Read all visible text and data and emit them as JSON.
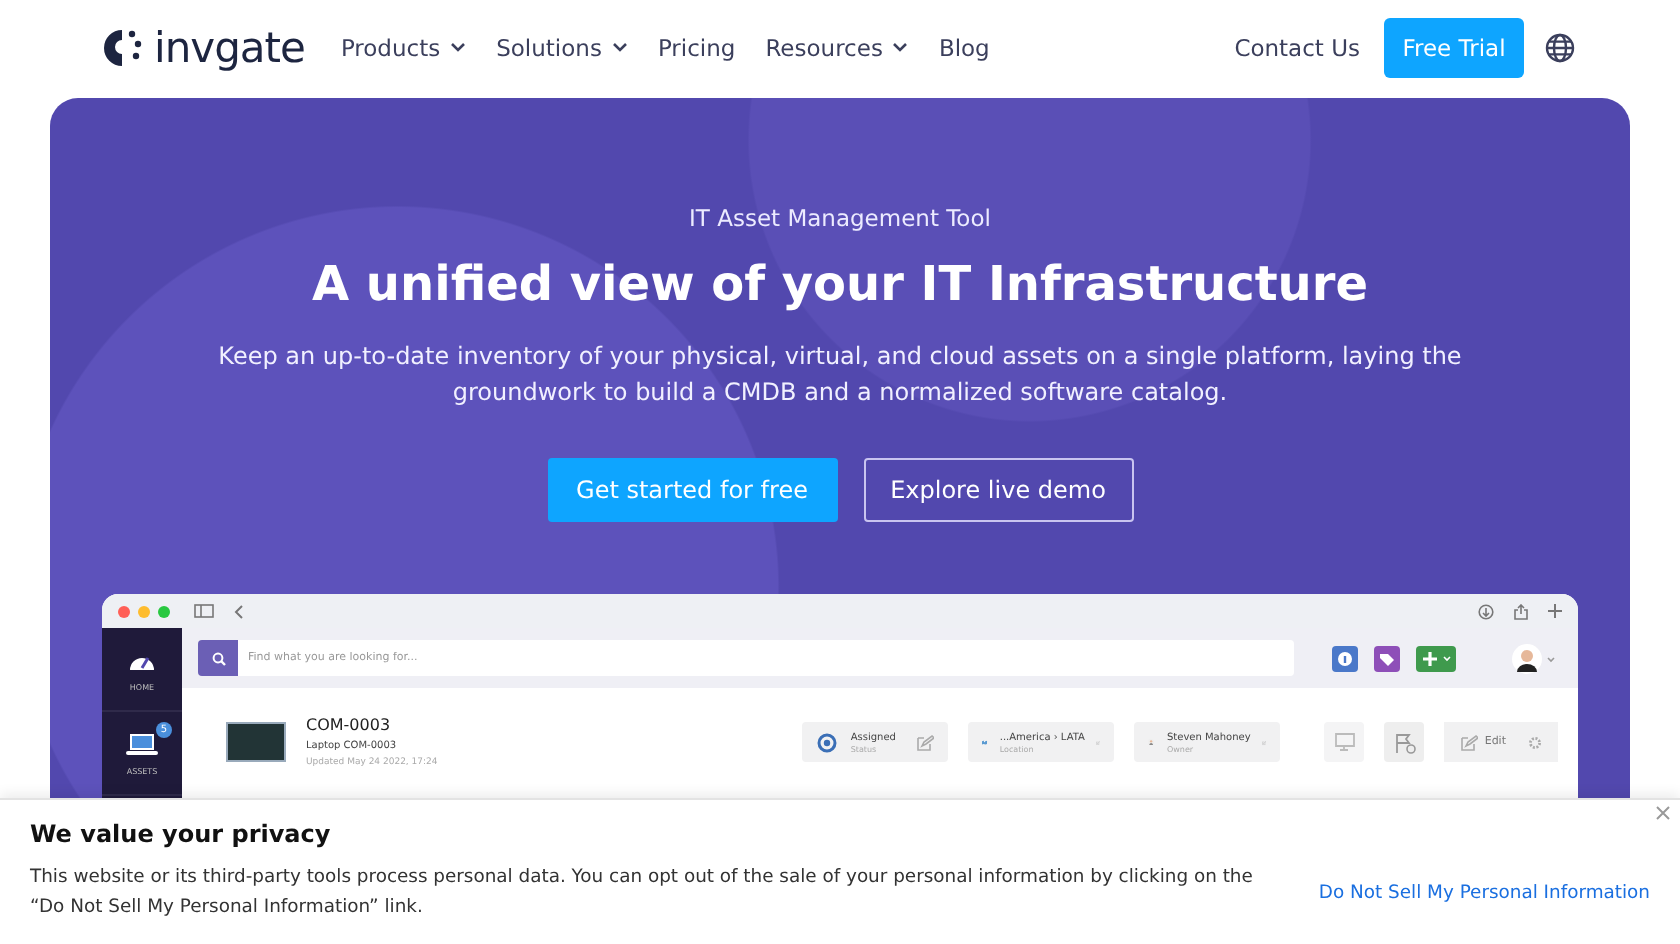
{
  "header": {
    "logo_text": "invgate",
    "nav": [
      {
        "label": "Products",
        "dropdown": true
      },
      {
        "label": "Solutions",
        "dropdown": true
      },
      {
        "label": "Pricing",
        "dropdown": false
      },
      {
        "label": "Resources",
        "dropdown": true
      },
      {
        "label": "Blog",
        "dropdown": false
      }
    ],
    "contact": "Contact Us",
    "cta": "Free Trial"
  },
  "hero": {
    "eyebrow": "IT Asset Management Tool",
    "title": "A unified view of your IT Infrastructure",
    "description": "Keep an up-to-date inventory of your physical, virtual, and cloud assets on a single platform, laying the groundwork to build a CMDB and a normalized software catalog.",
    "primary_button": "Get started for free",
    "secondary_button": "Explore live demo"
  },
  "app": {
    "search_placeholder": "Find what you are looking for...",
    "sidebar": [
      {
        "label": "HOME",
        "kind": "gauge"
      },
      {
        "label": "ASSETS",
        "kind": "laptop",
        "badge": "5"
      }
    ],
    "asset": {
      "id": "COM-0003",
      "name": "Laptop COM-0003",
      "updated": "Updated May 24 2022, 17:24"
    },
    "fields": [
      {
        "kind": "status",
        "value": "Assigned",
        "label": "Status"
      },
      {
        "kind": "location",
        "value": "...America › LATA",
        "label": "Location"
      },
      {
        "kind": "owner",
        "value": "Steven Mahoney",
        "label": "Owner"
      }
    ],
    "edit_button": "Edit"
  },
  "cookie": {
    "title": "We value your privacy",
    "text": "This website or its third-party tools process personal data. You can opt out of the sale of your personal information by clicking on the “Do Not Sell My Personal Information” link.",
    "link": "Do Not Sell My Personal Information"
  }
}
